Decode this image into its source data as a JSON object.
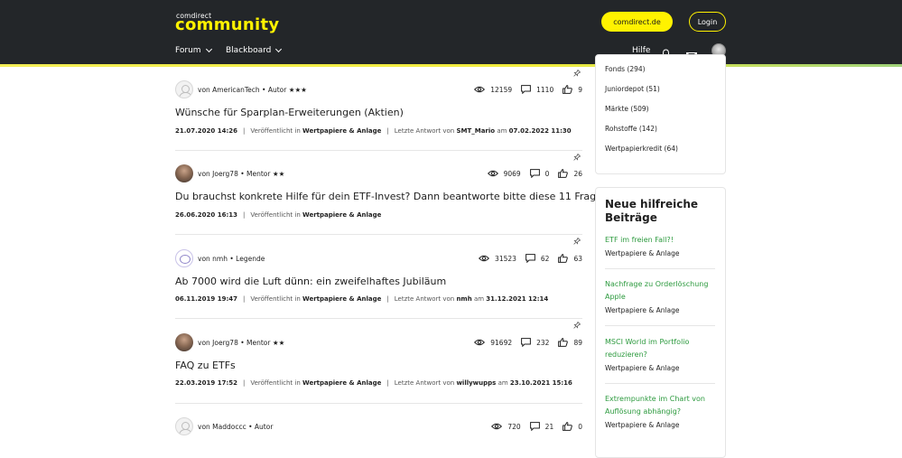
{
  "header": {
    "logo_small": "comdirect",
    "logo_big": "community",
    "btn_comdirect": "comdirect.de",
    "btn_login": "Login",
    "nav": [
      {
        "label": "Forum"
      },
      {
        "label": "Blackboard"
      }
    ],
    "hilfe": "Hilfe",
    "icons": [
      "bell-icon",
      "mail-icon"
    ],
    "colors": {
      "bg": "#232629",
      "accent": "#fff200",
      "link": "#2c9a3e"
    }
  },
  "posts": [
    {
      "author": "von AmericanTech • Autor ★★★",
      "views": "12159",
      "replies": "1110",
      "likes": "9",
      "title": "Wünsche für Sparplan-Erweiterungen (Aktien)",
      "date": "21.07.2020 14:26",
      "published_prefix": "Veröffentlicht in",
      "category": "Wertpapiere & Anlage",
      "last_prefix": "Letzte Antwort von",
      "last_user": "SMT_Mario",
      "last_mid": "am",
      "last_date": "07.02.2022 11:30"
    },
    {
      "author": "von Joerg78 • Mentor ★★",
      "views": "9069",
      "replies": "0",
      "likes": "26",
      "title": "Du brauchst konkrete Hilfe für dein ETF-Invest? Dann beantworte bitte diese 11 Fragen!",
      "date": "26.06.2020 16:13",
      "published_prefix": "Veröffentlicht in",
      "category": "Wertpapiere & Anlage"
    },
    {
      "author": "von nmh • Legende",
      "views": "31523",
      "replies": "62",
      "likes": "63",
      "title": "Ab 7000 wird die Luft dünn: ein zweifelhaftes Jubiläum",
      "date": "06.11.2019 19:47",
      "published_prefix": "Veröffentlicht in",
      "category": "Wertpapiere & Anlage",
      "last_prefix": "Letzte Antwort von",
      "last_user": "nmh",
      "last_mid": "am",
      "last_date": "31.12.2021 12:14"
    },
    {
      "author": "von Joerg78 • Mentor ★★",
      "views": "91692",
      "replies": "232",
      "likes": "89",
      "title": "FAQ zu ETFs",
      "date": "22.03.2019 17:52",
      "published_prefix": "Veröffentlicht in",
      "category": "Wertpapiere & Anlage",
      "last_prefix": "Letzte Antwort von",
      "last_user": "willywupps",
      "last_mid": "am",
      "last_date": "23.10.2021 15:16"
    },
    {
      "author": "von Maddoccc • Autor",
      "views": "720",
      "replies": "21",
      "likes": "0"
    }
  ],
  "sidebar": {
    "categories": [
      "Fonds (294)",
      "Juniordepot (51)",
      "Märkte (509)",
      "Rohstoffe (142)",
      "Wertpapierkredit (64)"
    ],
    "help_title": "Neue hilfreiche Beiträge",
    "help_items": [
      {
        "title": "ETF im freien Fall?!",
        "category": "Wertpapiere & Anlage"
      },
      {
        "title": "Nachfrage zu Orderlöschung Apple",
        "category": "Wertpapiere & Anlage"
      },
      {
        "title": "MSCI World im Portfolio reduzieren?",
        "category": "Wertpapiere & Anlage"
      },
      {
        "title": "Extrempunkte im Chart von Auflösung abhängig?",
        "category": "Wertpapiere & Anlage"
      }
    ]
  }
}
